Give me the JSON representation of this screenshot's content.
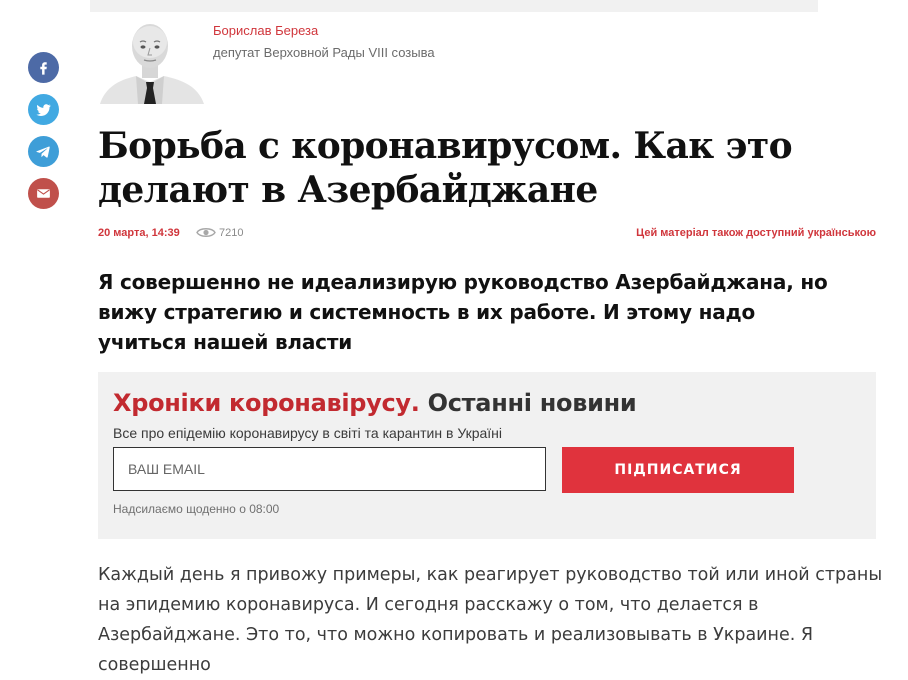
{
  "author": {
    "name": "Борислав Береза",
    "role": "депутат Верховной Рады VIII созыва"
  },
  "share": {
    "icons": [
      "facebook-icon",
      "twitter-icon",
      "telegram-icon",
      "mail-icon"
    ],
    "colors": {
      "facebook": "#4d6aa6",
      "twitter": "#41a9e2",
      "telegram": "#3e9ed8",
      "mail": "#c0504b"
    }
  },
  "article": {
    "title": "Борьба с коронавирусом. Как это делают в Азербайджане",
    "date": "20 марта, 14:39",
    "views": "7210",
    "lang_link": "Цей матеріал також доступний українською",
    "lead": "Я совершенно не идеализирую руководство Азербайджана, но вижу стратегию и системность в их работе. И этому надо учиться нашей власти",
    "body": "Каждый день я привожу примеры, как реагирует руководство той или иной страны на эпидемию коронавируса. И сегодня расскажу о том, что делается в Азербайджане. Это то, что можно копировать и реализовывать в Украине. Я совершенно"
  },
  "subscribe": {
    "title_red": "Хроніки коронавірусу.",
    "title_dark": "Останні новини",
    "description": "Все про епідемію коронавирусу в світі та карантин в Україні",
    "email_placeholder": "ВАШ EMAIL",
    "email_value": "",
    "button_label": "ПІДПИСАТИСЯ",
    "note": "Надсилаємо щоденно о 08:00"
  },
  "colors": {
    "accent": "#d0363c",
    "button": "#e0333d",
    "box_bg": "#f1f1f1"
  }
}
